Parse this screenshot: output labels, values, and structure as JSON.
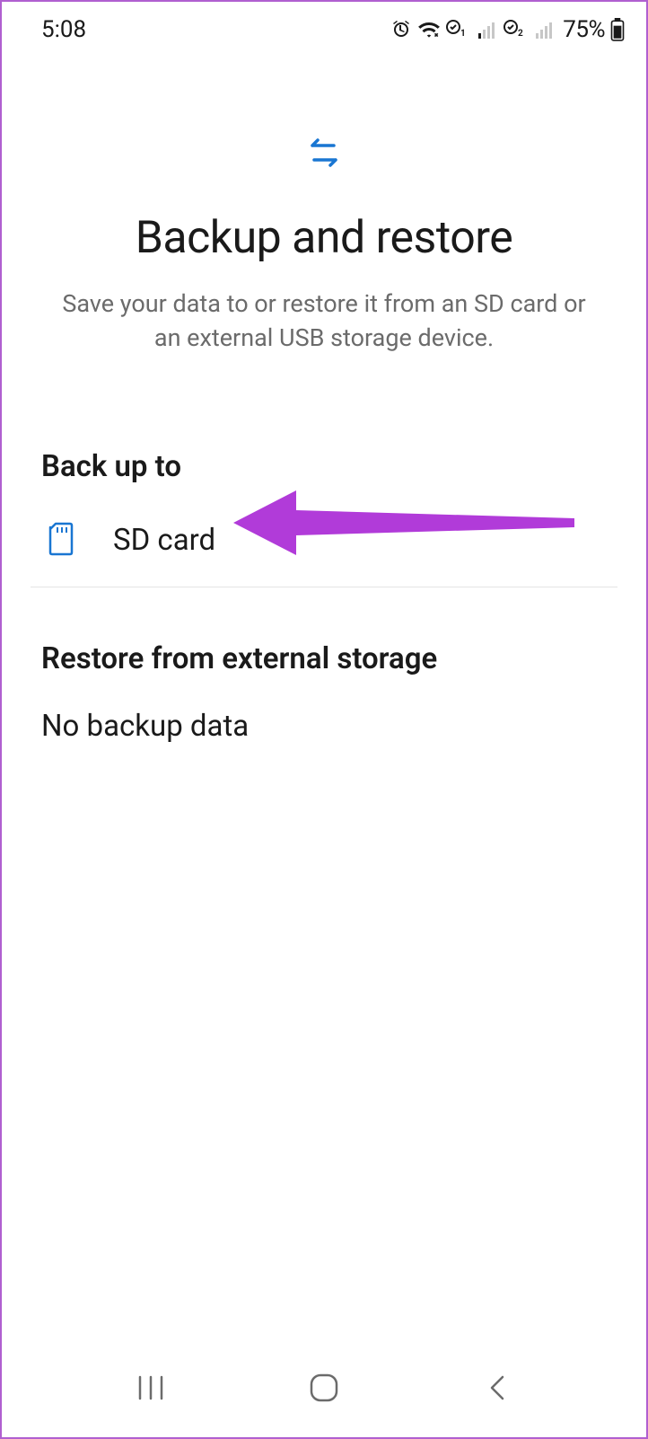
{
  "status": {
    "time": "5:08",
    "battery": "75%"
  },
  "hero": {
    "title": "Backup and restore",
    "subtitle": "Save your data to or restore it from an SD card or an external USB storage device."
  },
  "backup_section": {
    "header": "Back up to",
    "items": [
      {
        "label": "SD card",
        "icon": "sd-card"
      }
    ]
  },
  "restore_section": {
    "header": "Restore from external storage",
    "empty": "No backup data"
  },
  "annotation": {
    "arrow_color": "#b13bd9"
  }
}
